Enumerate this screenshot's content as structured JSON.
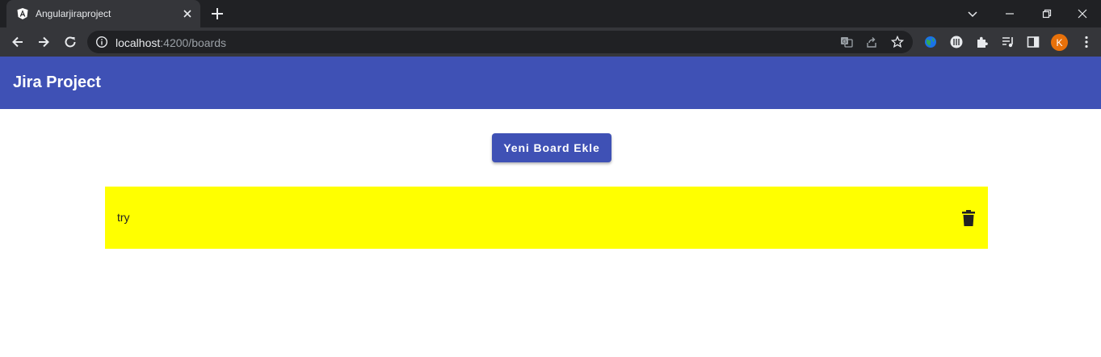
{
  "browser": {
    "tab": {
      "title": "Angularjiraproject",
      "favicon": "angular-logo-icon"
    },
    "address": {
      "host": "localhost",
      "path": ":4200/boards"
    },
    "profile_initial": "K"
  },
  "app": {
    "title": "Jira Project",
    "header_color": "#3f51b5"
  },
  "main": {
    "add_board_label": "Yeni Board Ekle",
    "boards": [
      {
        "name": "try",
        "color": "#ffff00",
        "action_icon": "trash-icon"
      }
    ]
  }
}
